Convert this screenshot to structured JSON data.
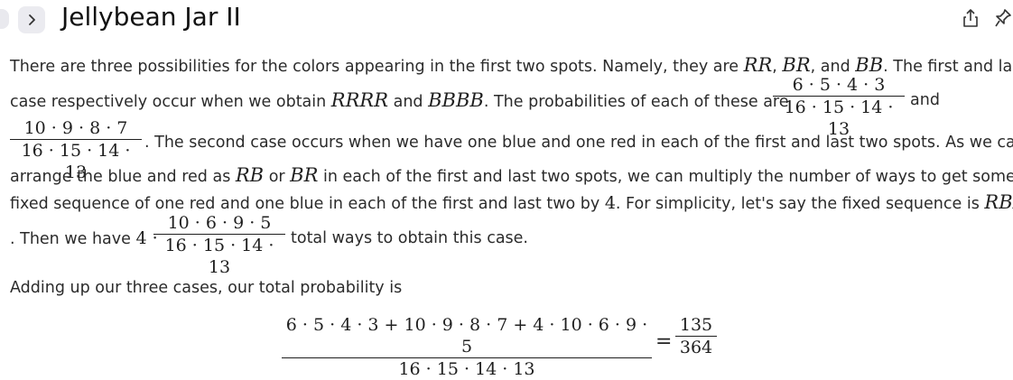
{
  "header": {
    "title": "Jellybean Jar II",
    "icons": [
      "chevron-right-icon",
      "share-icon",
      "pin-icon"
    ]
  },
  "para1": {
    "l1_a": "There are three possibilities for the colors appearing in the first two spots. Namely, they are ",
    "rr": "RR",
    "comma1": ", ",
    "br": "BR",
    "comma2": ", and ",
    "bb": "BB",
    "l1_b": ". The first and last",
    "l2_a": "case respectively occur when we obtain ",
    "rrrr": "RRRR",
    "and1": " and ",
    "bbbb": "BBBB",
    "l2_b": ". The probabilities of each of these are",
    "and2": "and",
    "frac1_num": "6 · 5 · 4 · 3",
    "frac1_den": "16 · 15 · 14 · 13",
    "frac2_num": "10 · 9 · 8 · 7",
    "frac2_den": "16 · 15 · 14 · 13",
    "l3": ". The second case occurs when we have one blue and one red in each of the first and last two spots. As we can",
    "l4_a": "arrange the blue and red as ",
    "rb": "RB",
    "or": " or ",
    "br2": "BR",
    "l4_b": " in each of the first and last two spots, we can multiply the number of ways to get some",
    "l5_a": "fixed sequence of one red and one blue in each of the first and last two by ",
    "four": "4",
    "l5_b": ". For simplicity, let's say the fixed sequence is ",
    "rbrb": "RBRB",
    "l6_a": ". Then we have ",
    "four_dot": "4 ·",
    "frac3_num": "10 · 6 · 9 · 5",
    "frac3_den": "16 · 15 · 14 · 13",
    "l6_b": "total ways to obtain this case."
  },
  "para2": {
    "text": "Adding up our three cases, our total probability is",
    "big_num": "6 · 5 · 4 · 3 + 10 · 9 · 8 · 7 + 4 · 10 · 6 · 9 · 5",
    "big_den": "16 · 15 · 14 · 13",
    "equals": "=",
    "res_num": "135",
    "res_den": "364"
  }
}
